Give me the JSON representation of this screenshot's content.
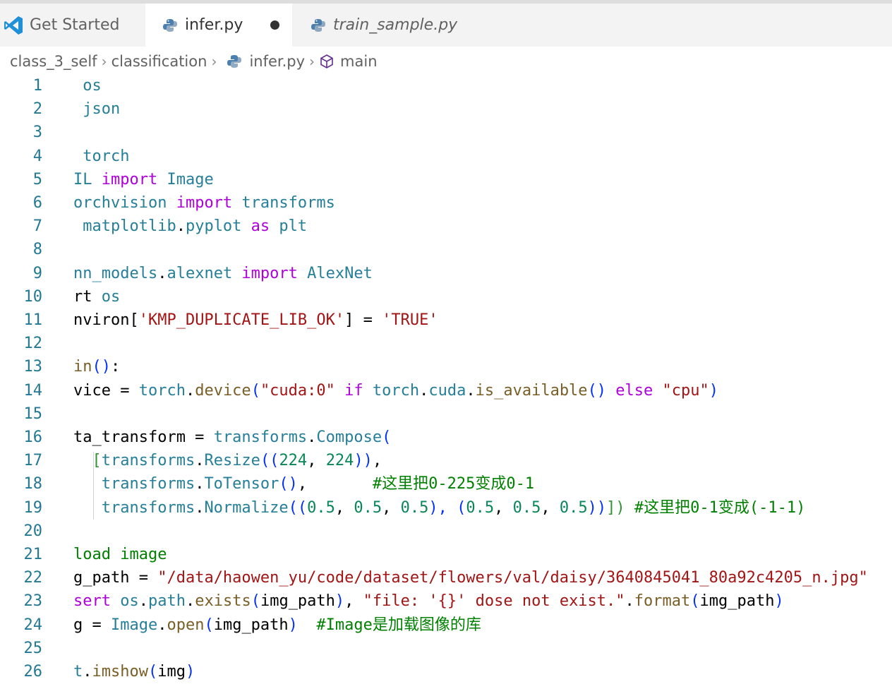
{
  "tabs": [
    {
      "label": "Get Started",
      "icon": "vscode-logo-icon",
      "active": false
    },
    {
      "label": "infer.py",
      "icon": "python-icon",
      "active": true,
      "dirty": true
    },
    {
      "label": "train_sample.py",
      "icon": "python-icon",
      "active": false,
      "preview": true
    }
  ],
  "breadcrumb": {
    "items": [
      "class_3_self",
      "classification",
      "infer.py",
      "main"
    ]
  },
  "colors": {
    "keyword": "#af00db",
    "type": "#267f99",
    "func": "#795e26",
    "string": "#a31515",
    "number": "#098658",
    "comment": "#008000",
    "line_number": "#237893",
    "bracket_blue": "#0431fa",
    "bracket_purple": "#319331"
  },
  "code_lines": [
    [
      {
        "t": " os",
        "c": "type"
      }
    ],
    [
      {
        "t": " json",
        "c": "type"
      }
    ],
    [],
    [
      {
        "t": " torch",
        "c": "type"
      }
    ],
    [
      {
        "t": "IL ",
        "c": "type"
      },
      {
        "t": "import",
        "c": "kw"
      },
      {
        "t": " Image",
        "c": "type"
      }
    ],
    [
      {
        "t": "orchvision ",
        "c": "type"
      },
      {
        "t": "import",
        "c": "kw"
      },
      {
        "t": " transforms",
        "c": "type"
      }
    ],
    [
      {
        "t": " matplotlib",
        "c": "type"
      },
      {
        "t": ".",
        "c": "plain"
      },
      {
        "t": "pyplot",
        "c": "type"
      },
      {
        "t": " as ",
        "c": "kw"
      },
      {
        "t": "plt",
        "c": "type"
      }
    ],
    [],
    [
      {
        "t": "nn_models",
        "c": "type"
      },
      {
        "t": ".",
        "c": "plain"
      },
      {
        "t": "alexnet",
        "c": "type"
      },
      {
        "t": " import ",
        "c": "kw"
      },
      {
        "t": "AlexNet",
        "c": "type"
      }
    ],
    [
      {
        "t": "rt ",
        "c": "plain"
      },
      {
        "t": "os",
        "c": "type"
      }
    ],
    [
      {
        "t": "nviron[",
        "c": "plain"
      },
      {
        "t": "'KMP_DUPLICATE_LIB_OK'",
        "c": "str"
      },
      {
        "t": "] = ",
        "c": "plain"
      },
      {
        "t": "'TRUE'",
        "c": "str"
      }
    ],
    [],
    [
      {
        "t": "in",
        "c": "func"
      },
      {
        "t": "()",
        "c": "bracket"
      },
      {
        "t": ":",
        "c": "plain"
      }
    ],
    [
      {
        "t": "vice = ",
        "c": "plain"
      },
      {
        "t": "torch",
        "c": "type"
      },
      {
        "t": ".",
        "c": "plain"
      },
      {
        "t": "device",
        "c": "func"
      },
      {
        "t": "(",
        "c": "bracket"
      },
      {
        "t": "\"cuda:0\"",
        "c": "str"
      },
      {
        "t": " if ",
        "c": "kw"
      },
      {
        "t": "torch",
        "c": "type"
      },
      {
        "t": ".",
        "c": "plain"
      },
      {
        "t": "cuda",
        "c": "type"
      },
      {
        "t": ".",
        "c": "plain"
      },
      {
        "t": "is_available",
        "c": "func"
      },
      {
        "t": "()",
        "c": "bracket"
      },
      {
        "t": " else ",
        "c": "kw"
      },
      {
        "t": "\"cpu\"",
        "c": "str"
      },
      {
        "t": ")",
        "c": "bracket"
      }
    ],
    [],
    [
      {
        "t": "ta_transform = ",
        "c": "plain"
      },
      {
        "t": "transforms",
        "c": "type"
      },
      {
        "t": ".",
        "c": "plain"
      },
      {
        "t": "Compose",
        "c": "type"
      },
      {
        "t": "(",
        "c": "bracket"
      }
    ],
    [
      {
        "t": "  [",
        "c": "bracket2"
      },
      {
        "t": "transforms",
        "c": "type"
      },
      {
        "t": ".",
        "c": "plain"
      },
      {
        "t": "Resize",
        "c": "type"
      },
      {
        "t": "((",
        "c": "bracket"
      },
      {
        "t": "224",
        "c": "num"
      },
      {
        "t": ", ",
        "c": "plain"
      },
      {
        "t": "224",
        "c": "num"
      },
      {
        "t": "))",
        "c": "bracket"
      },
      {
        "t": ",",
        "c": "plain"
      }
    ],
    [
      {
        "t": "   transforms",
        "c": "type"
      },
      {
        "t": ".",
        "c": "plain"
      },
      {
        "t": "ToTensor",
        "c": "type"
      },
      {
        "t": "()",
        "c": "bracket"
      },
      {
        "t": ",       ",
        "c": "plain"
      },
      {
        "t": "#这里把0-225变成0-1",
        "c": "com"
      }
    ],
    [
      {
        "t": "   transforms",
        "c": "type"
      },
      {
        "t": ".",
        "c": "plain"
      },
      {
        "t": "Normalize",
        "c": "type"
      },
      {
        "t": "((",
        "c": "bracket"
      },
      {
        "t": "0.5",
        "c": "num"
      },
      {
        "t": ", ",
        "c": "plain"
      },
      {
        "t": "0.5",
        "c": "num"
      },
      {
        "t": ", ",
        "c": "plain"
      },
      {
        "t": "0.5",
        "c": "num"
      },
      {
        "t": "), (",
        "c": "bracket"
      },
      {
        "t": "0.5",
        "c": "num"
      },
      {
        "t": ", ",
        "c": "plain"
      },
      {
        "t": "0.5",
        "c": "num"
      },
      {
        "t": ", ",
        "c": "plain"
      },
      {
        "t": "0.5",
        "c": "num"
      },
      {
        "t": "))",
        "c": "bracket"
      },
      {
        "t": "])",
        "c": "bracket2"
      },
      {
        "t": " #这里把0-1变成(-1-1)",
        "c": "com"
      }
    ],
    [],
    [
      {
        "t": "load image",
        "c": "com"
      }
    ],
    [
      {
        "t": "g_path = ",
        "c": "plain"
      },
      {
        "t": "\"/data/haowen_yu/code/dataset/flowers/val/daisy/3640845041_80a92c4205_n.jpg\"",
        "c": "str"
      }
    ],
    [
      {
        "t": "sert ",
        "c": "kw"
      },
      {
        "t": "os",
        "c": "type"
      },
      {
        "t": ".",
        "c": "plain"
      },
      {
        "t": "path",
        "c": "type"
      },
      {
        "t": ".",
        "c": "plain"
      },
      {
        "t": "exists",
        "c": "func"
      },
      {
        "t": "(",
        "c": "bracket"
      },
      {
        "t": "img_path",
        "c": "plain"
      },
      {
        "t": ")",
        "c": "bracket"
      },
      {
        "t": ", ",
        "c": "plain"
      },
      {
        "t": "\"file: '{}' dose not exist.\"",
        "c": "str"
      },
      {
        "t": ".",
        "c": "plain"
      },
      {
        "t": "format",
        "c": "func"
      },
      {
        "t": "(",
        "c": "bracket"
      },
      {
        "t": "img_path",
        "c": "plain"
      },
      {
        "t": ")",
        "c": "bracket"
      }
    ],
    [
      {
        "t": "g = ",
        "c": "plain"
      },
      {
        "t": "Image",
        "c": "type"
      },
      {
        "t": ".",
        "c": "plain"
      },
      {
        "t": "open",
        "c": "func"
      },
      {
        "t": "(",
        "c": "bracket"
      },
      {
        "t": "img_path",
        "c": "plain"
      },
      {
        "t": ")",
        "c": "bracket"
      },
      {
        "t": "  #Image是加载图像的库",
        "c": "com"
      }
    ],
    [],
    [
      {
        "t": "t",
        "c": "type"
      },
      {
        "t": ".",
        "c": "plain"
      },
      {
        "t": "imshow",
        "c": "func"
      },
      {
        "t": "(",
        "c": "bracket"
      },
      {
        "t": "img",
        "c": "plain"
      },
      {
        "t": ")",
        "c": "bracket"
      }
    ]
  ]
}
